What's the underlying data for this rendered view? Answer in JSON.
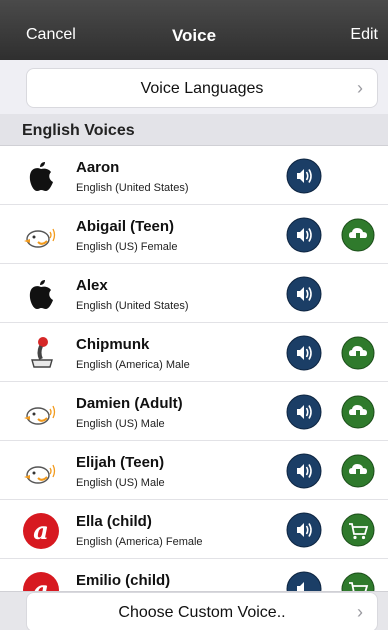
{
  "navbar": {
    "cancel": "Cancel",
    "title": "Voice",
    "edit": "Edit"
  },
  "voice_languages": {
    "label": "Voice Languages",
    "chevron": "›"
  },
  "section": {
    "title": "English Voices"
  },
  "voices": [
    {
      "name": "Aaron",
      "subtitle": "English (United States)",
      "avatar": "apple-logo-icon",
      "action": "none"
    },
    {
      "name": "Abigail (Teen)",
      "subtitle": "English (US) Female",
      "avatar": "bird-icon",
      "action": "download"
    },
    {
      "name": "Alex",
      "subtitle": "English (United States)",
      "avatar": "apple-logo-icon",
      "action": "none"
    },
    {
      "name": "Chipmunk",
      "subtitle": "English (America) Male",
      "avatar": "joystick-icon",
      "action": "download"
    },
    {
      "name": "Damien (Adult)",
      "subtitle": "English (US) Male",
      "avatar": "bird-icon",
      "action": "download"
    },
    {
      "name": "Elijah (Teen)",
      "subtitle": "English (US) Male",
      "avatar": "bird-icon",
      "action": "download"
    },
    {
      "name": "Ella (child)",
      "subtitle": "English (America) Female",
      "avatar": "acapela-logo-icon",
      "action": "cart"
    },
    {
      "name": "Emilio (child)",
      "subtitle": "",
      "avatar": "acapela-logo-icon",
      "action": "cart"
    }
  ],
  "custom_voice": {
    "label": "Choose Custom Voice..",
    "chevron": "›"
  },
  "colors": {
    "navbar": "#3a3a3a",
    "play_button": "#1b3e66",
    "download_button": "#2f7a2c"
  }
}
